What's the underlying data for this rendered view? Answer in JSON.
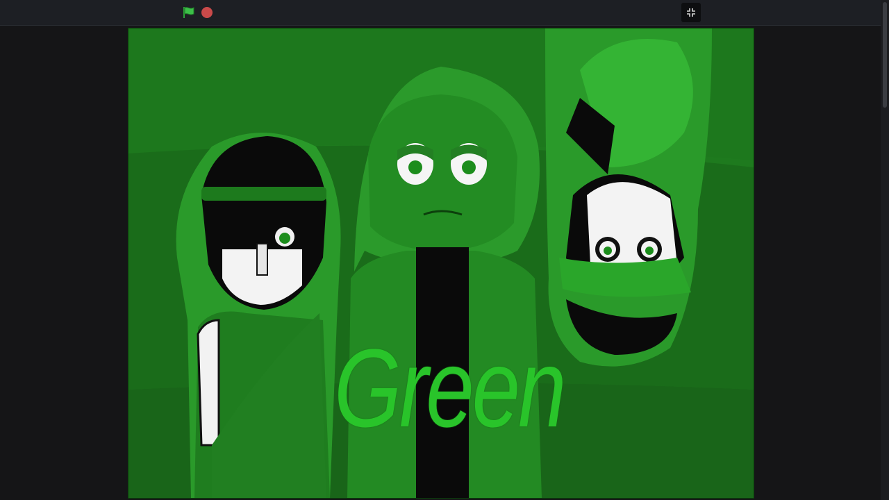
{
  "toolbar": {
    "green_flag_icon": "green-flag-icon",
    "stop_icon": "stop-sign-icon",
    "fullscreen_icon": "exit-fullscreen-icon"
  },
  "stage": {
    "title": "Green"
  },
  "colors": {
    "stage_bg": "#1b6e1b",
    "title": "#29c42a",
    "topbar": "#1d1f24",
    "page_bg": "#151517"
  }
}
